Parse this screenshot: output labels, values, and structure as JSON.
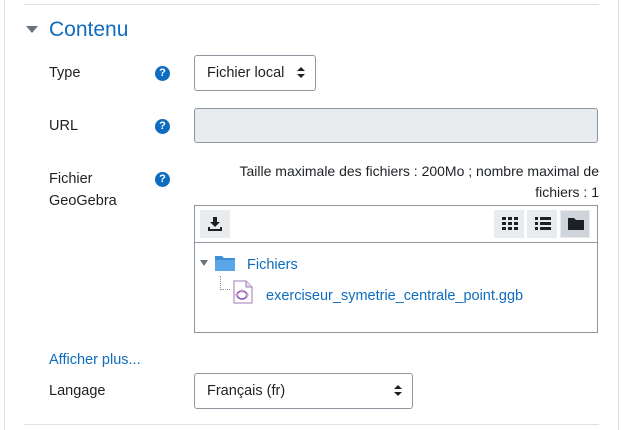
{
  "section": {
    "title": "Contenu",
    "toggle_icon": "caret-down-icon"
  },
  "fields": {
    "type": {
      "label": "Type",
      "value": "Fichier local"
    },
    "url": {
      "label": "URL",
      "value": ""
    },
    "file": {
      "label_line1": "Fichier",
      "label_line2": "GeoGebra",
      "max_line1": "Taille maximale des fichiers : 200Mo ; nombre maximal de",
      "max_line2": "fichiers : 1"
    },
    "language": {
      "label": "Langage",
      "value": "Français (fr)"
    }
  },
  "help_icon_glyph": "?",
  "filemanager": {
    "toolbar": {
      "download": "download-icon",
      "views": [
        "grid-view-icon",
        "list-view-icon",
        "folder-view-icon"
      ],
      "active_view": "folder-view-icon"
    },
    "tree": {
      "folder": "Fichiers",
      "file": "exerciseur_symetrie_centrale_point.ggb"
    }
  },
  "show_more": "Afficher plus...",
  "colors": {
    "accent": "#0f6cbf",
    "text": "#1d2125",
    "border": "#8f959e",
    "disabled": "#e9ecef"
  }
}
